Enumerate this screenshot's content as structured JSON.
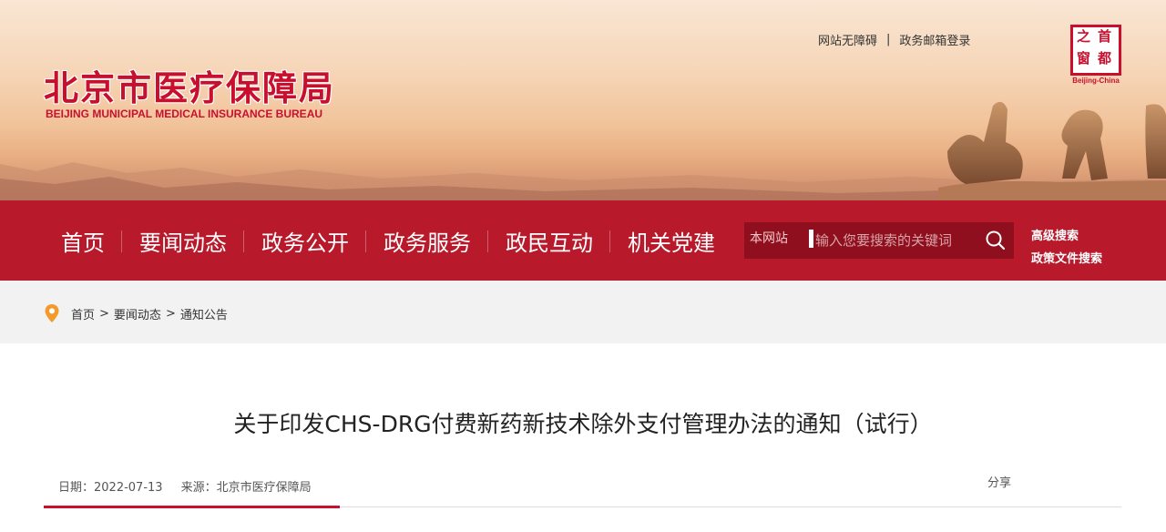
{
  "header": {
    "logo_cn": "北京市医疗保障局",
    "logo_en": "BEIJING MUNICIPAL MEDICAL INSURANCE BUREAU",
    "top_links": [
      "网站无障碍",
      "政务邮箱登录"
    ],
    "top_sep": "|",
    "capital_logo": {
      "chars": [
        "之",
        "首",
        "窗",
        "都"
      ],
      "en": "Beijing-China"
    }
  },
  "nav": {
    "items": [
      "首页",
      "要闻动态",
      "政务公开",
      "政务服务",
      "政民互动",
      "机关党建"
    ]
  },
  "search": {
    "scope": "本网站",
    "placeholder": "输入您要搜索的关键词",
    "icon": "search-icon",
    "advanced": [
      "高级搜索",
      "政策文件搜索"
    ]
  },
  "breadcrumb": {
    "icon": "location-pin-icon",
    "items": [
      "首页",
      "要闻动态",
      "通知公告"
    ],
    "separator": ">"
  },
  "article": {
    "title": "关于印发CHS-DRG付费新药新技术除外支付管理办法的通知（试行）",
    "date": "日期：2022-07-13",
    "source": "来源：北京市医疗保障局",
    "share": "分享"
  },
  "colors": {
    "brand_red": "#b8192b",
    "search_bg": "#8f0f1e",
    "pin_orange": "#f39a2b"
  }
}
